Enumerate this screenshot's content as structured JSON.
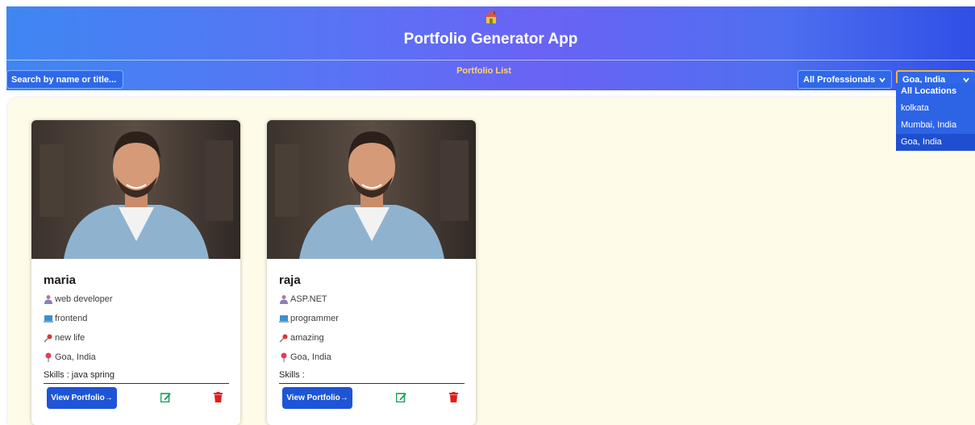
{
  "header": {
    "title": "Portfolio Generator App",
    "logo_icon": "house-icon",
    "search_placeholder": "Search by name or title...",
    "nav_link": "Portfolio List",
    "professionals_filter": "All Professionals",
    "location_filter": "Goa, India"
  },
  "location_dropdown": {
    "options": [
      "All Locations",
      "kolkata",
      "Mumbai, India",
      "Goa, India"
    ],
    "selected": "Goa, India"
  },
  "cards": [
    {
      "name": "maria",
      "title": "web developer",
      "category": "frontend",
      "tagline": "new life",
      "location": "Goa, India",
      "skills_label": "Skills :",
      "skills": "java  spring",
      "view_label": "View Portfolio→"
    },
    {
      "name": "raja",
      "title": "ASP.NET",
      "category": "programmer",
      "tagline": "amazing",
      "location": "Goa, India",
      "skills_label": "Skills :",
      "skills": "",
      "view_label": "View Portfolio→"
    }
  ],
  "colors": {
    "header_start": "#3f86f2",
    "header_end": "#2f4fe6",
    "accent_link": "#ffd76a",
    "button": "#1e55d6",
    "content_bg": "#fefbe8",
    "edit_icon": "#18a058",
    "delete_icon": "#e01e1e",
    "select_border_active": "#f3b73a"
  }
}
